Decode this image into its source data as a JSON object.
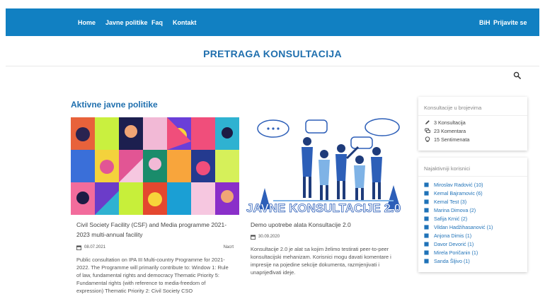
{
  "nav": {
    "home": "Home",
    "policies": "Javne politike",
    "faq": "Faq",
    "contact": "Kontakt",
    "language": "BiH",
    "login": "Prijavite se"
  },
  "page_title": "PRETRAGA KONSULTACIJA",
  "section_heading": "Aktivne javne politike",
  "cards": [
    {
      "title": "Civil Society Facility (CSF) and Media programme 2021-2023 multi-annual facility",
      "date": "08.07.2021",
      "status": "Nacrt",
      "description": "Public consultation on IPA III Multi-country Programme for 2021-2022. The Programme will primarily contribute to: Window 1: Rule of law, fundamental rights and democracy Thematic Priority 5: Fundamental rights (with reference to media-freedom of expression) Thematic Priority 2: Civil Society CSO"
    },
    {
      "image_text": "JAVNE KONSULTACIJE 2.0",
      "title": "Demo upotrebe alata Konsultacije 2.0",
      "date": "30.09.2020",
      "description": "Konsultacije 2.0 je alat sa kojim želimo testirati peer-to-peer konsultacijski mehanizam. Korisnici mogu davati komentare i impresije na pojedine sekcije dokumenta, razmjenjivati i unaprijeđivati ideje."
    }
  ],
  "stats_box": {
    "title": "Konsultacije u brojevima",
    "items": [
      {
        "icon": "pencil-icon",
        "text": "3 Konsultacija"
      },
      {
        "icon": "comments-icon",
        "text": "23 Komentara"
      },
      {
        "icon": "sentiment-icon",
        "text": "15 Sentimenata"
      }
    ]
  },
  "users_box": {
    "title": "Najaktivniji korisnici",
    "users": [
      "Miroslav Radović (10)",
      "Kemal Bajramovic (6)",
      "Kemal Test (3)",
      "Marina Dimova (2)",
      "Safija Krnić (2)",
      "Vildan Hadžihasanović (1)",
      "Anjona Dimis (1)",
      "Davor Devorić (1)",
      "Mirela Poričanin (1)",
      "Sanda Šljivo (1)"
    ]
  },
  "colors": {
    "brand": "#1180c2",
    "heading": "#1f6fae",
    "user_link": "#1f72b8"
  }
}
